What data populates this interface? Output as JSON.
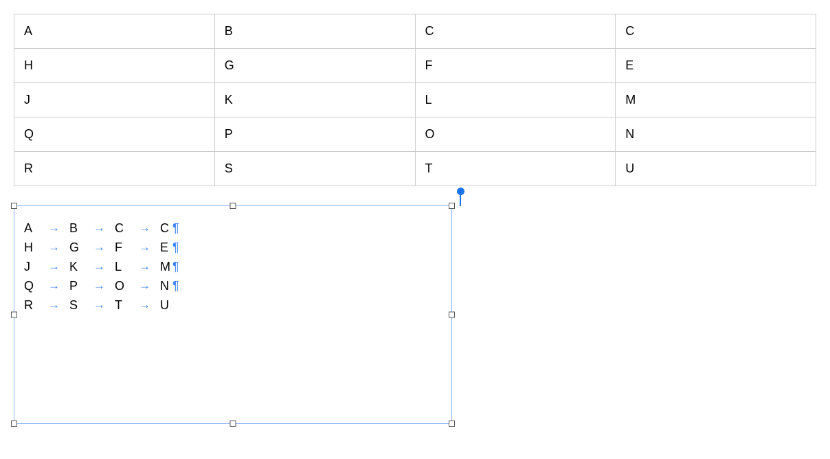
{
  "table": {
    "rows": [
      [
        "A",
        "B",
        "C",
        "C"
      ],
      [
        "H",
        "G",
        "F",
        "E"
      ],
      [
        "J",
        "K",
        "L",
        "M"
      ],
      [
        "Q",
        "P",
        "O",
        "N"
      ],
      [
        "R",
        "S",
        "T",
        "U"
      ]
    ]
  },
  "textbox": {
    "lines": [
      {
        "cells": [
          "A",
          "B",
          "C",
          "C"
        ],
        "has_pilcrow": true
      },
      {
        "cells": [
          "H",
          "G",
          "F",
          "E"
        ],
        "has_pilcrow": true
      },
      {
        "cells": [
          "J",
          "K",
          "L",
          "M"
        ],
        "has_pilcrow": true
      },
      {
        "cells": [
          "Q",
          "P",
          "O",
          "N"
        ],
        "has_pilcrow": true
      },
      {
        "cells": [
          "R",
          "S",
          "T",
          "U"
        ],
        "has_pilcrow": false
      }
    ],
    "tab_glyph": "→",
    "pilcrow_glyph": "¶"
  }
}
